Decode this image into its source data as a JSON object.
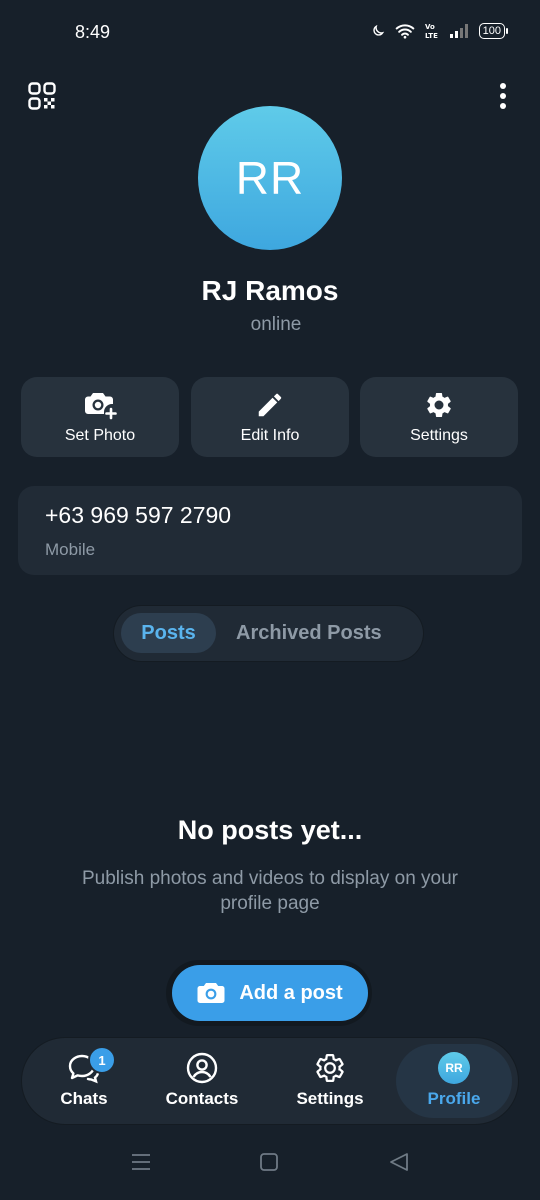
{
  "status_bar": {
    "time": "8:49",
    "battery": "100",
    "icons": [
      "moon-icon",
      "wifi-icon",
      "volte-icon",
      "signal-icon",
      "battery-icon"
    ]
  },
  "header": {
    "qr_icon": "qr-code-icon",
    "menu_icon": "more-vertical-icon"
  },
  "profile": {
    "initials": "RR",
    "name": "RJ Ramos",
    "status": "online"
  },
  "actions": [
    {
      "label": "Set Photo",
      "icon": "camera-add-icon"
    },
    {
      "label": "Edit Info",
      "icon": "pencil-icon"
    },
    {
      "label": "Settings",
      "icon": "gear-icon"
    }
  ],
  "phone": {
    "number": "+63 969 597 2790",
    "label": "Mobile"
  },
  "tabs": {
    "posts": "Posts",
    "archived": "Archived Posts",
    "active": "Posts"
  },
  "empty_state": {
    "title": "No posts yet...",
    "subtitle": "Publish photos and videos to display on your profile page"
  },
  "add_post": {
    "label": "Add a post",
    "icon": "camera-icon"
  },
  "bottom_nav": {
    "items": [
      {
        "label": "Chats",
        "icon": "chat-icon",
        "badge": "1"
      },
      {
        "label": "Contacts",
        "icon": "contacts-icon"
      },
      {
        "label": "Settings",
        "icon": "gear-icon"
      },
      {
        "label": "Profile",
        "icon": "avatar",
        "initials": "RR"
      }
    ],
    "active": "Profile"
  },
  "colors": {
    "background": "#17202a",
    "card": "#27323d",
    "accent": "#3a9ee8",
    "muted_text": "#8e9aa6"
  }
}
